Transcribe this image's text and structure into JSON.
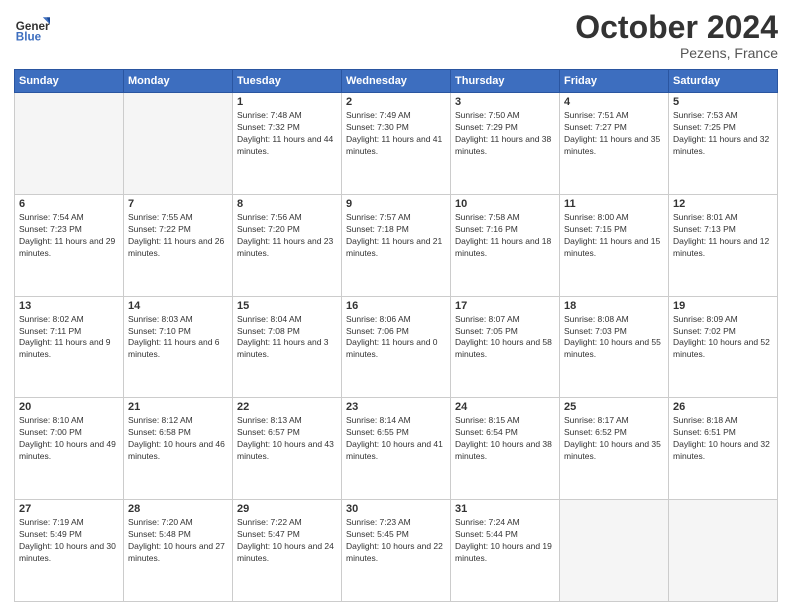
{
  "header": {
    "logo_line1": "General",
    "logo_line2": "Blue",
    "month": "October 2024",
    "location": "Pezens, France"
  },
  "days_of_week": [
    "Sunday",
    "Monday",
    "Tuesday",
    "Wednesday",
    "Thursday",
    "Friday",
    "Saturday"
  ],
  "weeks": [
    [
      {
        "day": "",
        "empty": true
      },
      {
        "day": "",
        "empty": true
      },
      {
        "day": "1",
        "sunrise": "7:48 AM",
        "sunset": "7:32 PM",
        "daylight": "11 hours and 44 minutes."
      },
      {
        "day": "2",
        "sunrise": "7:49 AM",
        "sunset": "7:30 PM",
        "daylight": "11 hours and 41 minutes."
      },
      {
        "day": "3",
        "sunrise": "7:50 AM",
        "sunset": "7:29 PM",
        "daylight": "11 hours and 38 minutes."
      },
      {
        "day": "4",
        "sunrise": "7:51 AM",
        "sunset": "7:27 PM",
        "daylight": "11 hours and 35 minutes."
      },
      {
        "day": "5",
        "sunrise": "7:53 AM",
        "sunset": "7:25 PM",
        "daylight": "11 hours and 32 minutes."
      }
    ],
    [
      {
        "day": "6",
        "sunrise": "7:54 AM",
        "sunset": "7:23 PM",
        "daylight": "11 hours and 29 minutes."
      },
      {
        "day": "7",
        "sunrise": "7:55 AM",
        "sunset": "7:22 PM",
        "daylight": "11 hours and 26 minutes."
      },
      {
        "day": "8",
        "sunrise": "7:56 AM",
        "sunset": "7:20 PM",
        "daylight": "11 hours and 23 minutes."
      },
      {
        "day": "9",
        "sunrise": "7:57 AM",
        "sunset": "7:18 PM",
        "daylight": "11 hours and 21 minutes."
      },
      {
        "day": "10",
        "sunrise": "7:58 AM",
        "sunset": "7:16 PM",
        "daylight": "11 hours and 18 minutes."
      },
      {
        "day": "11",
        "sunrise": "8:00 AM",
        "sunset": "7:15 PM",
        "daylight": "11 hours and 15 minutes."
      },
      {
        "day": "12",
        "sunrise": "8:01 AM",
        "sunset": "7:13 PM",
        "daylight": "11 hours and 12 minutes."
      }
    ],
    [
      {
        "day": "13",
        "sunrise": "8:02 AM",
        "sunset": "7:11 PM",
        "daylight": "11 hours and 9 minutes."
      },
      {
        "day": "14",
        "sunrise": "8:03 AM",
        "sunset": "7:10 PM",
        "daylight": "11 hours and 6 minutes."
      },
      {
        "day": "15",
        "sunrise": "8:04 AM",
        "sunset": "7:08 PM",
        "daylight": "11 hours and 3 minutes."
      },
      {
        "day": "16",
        "sunrise": "8:06 AM",
        "sunset": "7:06 PM",
        "daylight": "11 hours and 0 minutes."
      },
      {
        "day": "17",
        "sunrise": "8:07 AM",
        "sunset": "7:05 PM",
        "daylight": "10 hours and 58 minutes."
      },
      {
        "day": "18",
        "sunrise": "8:08 AM",
        "sunset": "7:03 PM",
        "daylight": "10 hours and 55 minutes."
      },
      {
        "day": "19",
        "sunrise": "8:09 AM",
        "sunset": "7:02 PM",
        "daylight": "10 hours and 52 minutes."
      }
    ],
    [
      {
        "day": "20",
        "sunrise": "8:10 AM",
        "sunset": "7:00 PM",
        "daylight": "10 hours and 49 minutes."
      },
      {
        "day": "21",
        "sunrise": "8:12 AM",
        "sunset": "6:58 PM",
        "daylight": "10 hours and 46 minutes."
      },
      {
        "day": "22",
        "sunrise": "8:13 AM",
        "sunset": "6:57 PM",
        "daylight": "10 hours and 43 minutes."
      },
      {
        "day": "23",
        "sunrise": "8:14 AM",
        "sunset": "6:55 PM",
        "daylight": "10 hours and 41 minutes."
      },
      {
        "day": "24",
        "sunrise": "8:15 AM",
        "sunset": "6:54 PM",
        "daylight": "10 hours and 38 minutes."
      },
      {
        "day": "25",
        "sunrise": "8:17 AM",
        "sunset": "6:52 PM",
        "daylight": "10 hours and 35 minutes."
      },
      {
        "day": "26",
        "sunrise": "8:18 AM",
        "sunset": "6:51 PM",
        "daylight": "10 hours and 32 minutes."
      }
    ],
    [
      {
        "day": "27",
        "sunrise": "7:19 AM",
        "sunset": "5:49 PM",
        "daylight": "10 hours and 30 minutes."
      },
      {
        "day": "28",
        "sunrise": "7:20 AM",
        "sunset": "5:48 PM",
        "daylight": "10 hours and 27 minutes."
      },
      {
        "day": "29",
        "sunrise": "7:22 AM",
        "sunset": "5:47 PM",
        "daylight": "10 hours and 24 minutes."
      },
      {
        "day": "30",
        "sunrise": "7:23 AM",
        "sunset": "5:45 PM",
        "daylight": "10 hours and 22 minutes."
      },
      {
        "day": "31",
        "sunrise": "7:24 AM",
        "sunset": "5:44 PM",
        "daylight": "10 hours and 19 minutes."
      },
      {
        "day": "",
        "empty": true
      },
      {
        "day": "",
        "empty": true
      }
    ]
  ]
}
